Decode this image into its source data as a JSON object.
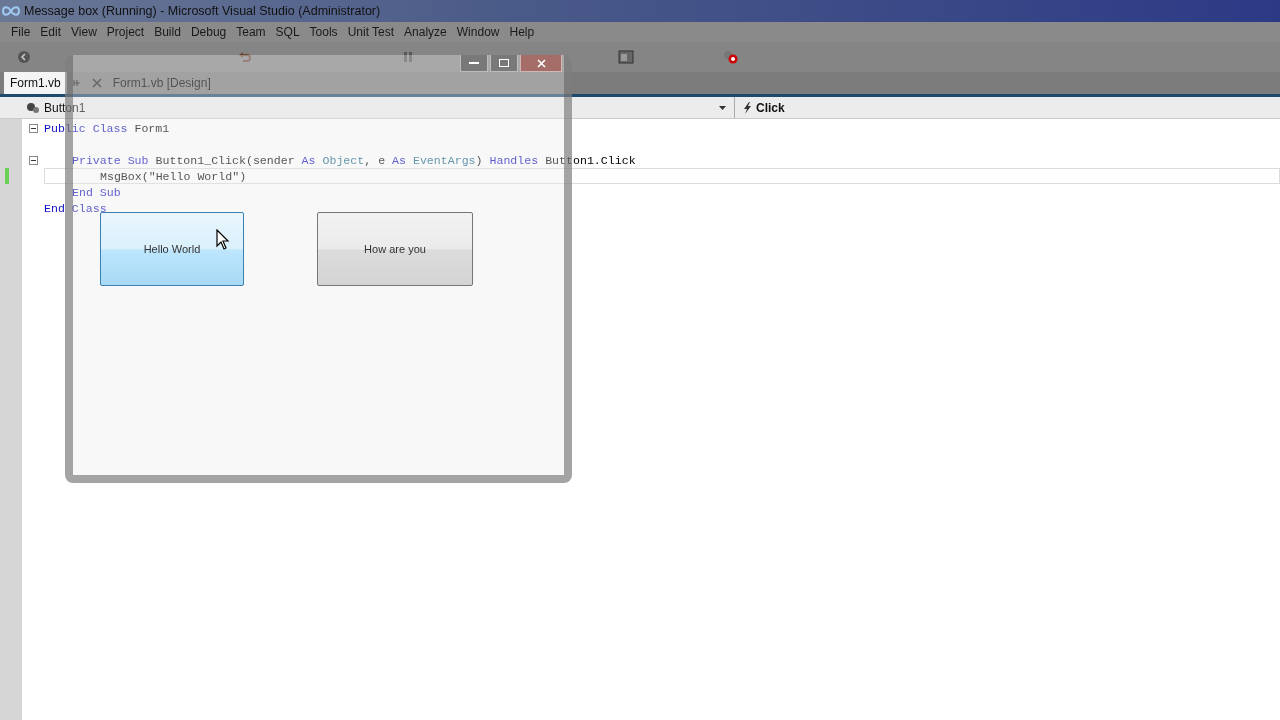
{
  "window": {
    "title": "Message box (Running) - Microsoft Visual Studio (Administrator)"
  },
  "menu": [
    "File",
    "Edit",
    "View",
    "Project",
    "Build",
    "Debug",
    "Team",
    "SQL",
    "Tools",
    "Unit Test",
    "Analyze",
    "Window",
    "Help"
  ],
  "tabs": [
    {
      "label": "Form1.vb",
      "selected": true
    },
    {
      "label": "Form1.vb [Design]",
      "selected": false
    }
  ],
  "navigation": {
    "object": "Button1",
    "event": "Click"
  },
  "code": [
    {
      "kind": "block",
      "current": false,
      "segments": [
        {
          "text": "Public",
          "kind": "keyword"
        },
        {
          "text": " Class",
          "kind": "keyword"
        },
        {
          "text": " Form1",
          "kind": "plain"
        }
      ],
      "children": [
        {
          "kind": "blank"
        },
        {
          "kind": "block",
          "current": false,
          "segments": [
            {
              "text": "Private",
              "kind": "keyword"
            },
            {
              "text": " Sub",
              "kind": "keyword"
            },
            {
              "text": " Button1_Click(sender ",
              "kind": "plain"
            },
            {
              "text": "As",
              "kind": "keyword"
            },
            {
              "text": " Object",
              "kind": "type"
            },
            {
              "text": ", e ",
              "kind": "plain"
            },
            {
              "text": "As",
              "kind": "keyword"
            },
            {
              "text": " EventArgs",
              "kind": "type"
            },
            {
              "text": ") ",
              "kind": "plain"
            },
            {
              "text": "Handles",
              "kind": "keyword"
            },
            {
              "text": " Button1.Click",
              "kind": "plain"
            }
          ],
          "children": [
            {
              "kind": "line",
              "current": true,
              "segments": [
                {
                  "text": "MsgBox(\"Hello World\")",
                  "kind": "plain"
                }
              ]
            }
          ]
        },
        {
          "kind": "line",
          "current": false,
          "segments": [
            {
              "text": "End",
              "kind": "keyword"
            },
            {
              "text": " Sub",
              "kind": "keyword"
            }
          ]
        }
      ]
    },
    {
      "kind": "line",
      "current": false,
      "segments": [
        {
          "text": "End",
          "kind": "keyword"
        },
        {
          "text": " Class",
          "kind": "keyword"
        }
      ]
    }
  ],
  "running_form": {
    "buttons": [
      {
        "label": "Hello World",
        "hovered": true
      },
      {
        "label": "How are you",
        "hovered": false
      }
    ]
  }
}
